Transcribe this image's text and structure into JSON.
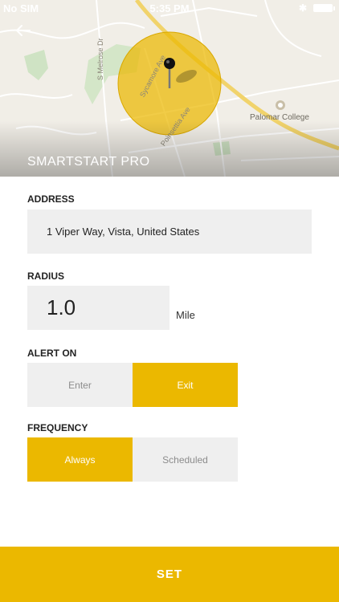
{
  "status_bar": {
    "carrier": "No SIM",
    "time": "5:35 PM"
  },
  "map": {
    "title": "SMARTSTART PRO",
    "labels": {
      "street_1": "S Melrose Dr",
      "street_2": "Sycamore Ave",
      "street_3": "Poinsettia Ave",
      "poi": "Palomar College"
    },
    "colors": {
      "geofence": "#ebb800",
      "pin": "#111111"
    }
  },
  "form": {
    "address_label": "ADDRESS",
    "address_value": "1 Viper Way, Vista, United States",
    "radius_label": "RADIUS",
    "radius_value": "1.0",
    "radius_unit": "Mile",
    "alert_label": "ALERT ON",
    "alert_options": {
      "enter": "Enter",
      "exit": "Exit",
      "selected": "Exit"
    },
    "frequency_label": "FREQUENCY",
    "frequency_options": {
      "always": "Always",
      "scheduled": "Scheduled",
      "selected": "Always"
    }
  },
  "footer": {
    "set_label": "SET"
  },
  "theme": {
    "accent": "#ebb800",
    "field_bg": "#efefef"
  }
}
